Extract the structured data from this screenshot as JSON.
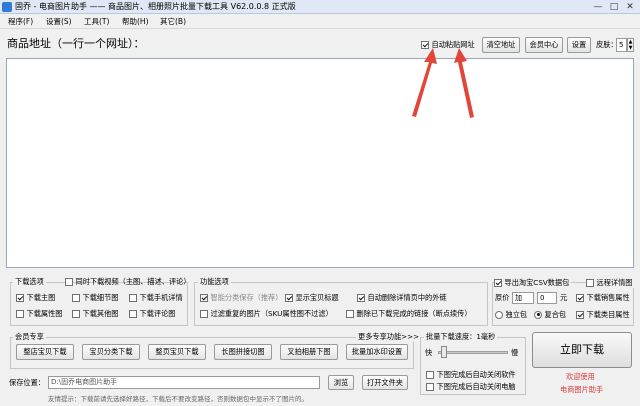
{
  "window": {
    "title": "固乔 - 电商图片助手 —— 商品图片、相册照片批量下载工具 V62.0.0.8 正式版",
    "minimize": "—",
    "maximize": "□",
    "close": "✕"
  },
  "menu": [
    "程序(F)",
    "设置(S)",
    "工具(T)",
    "帮助(H)",
    "其它(B)"
  ],
  "top": {
    "heading": "商品地址（一行一个网址）：",
    "auto_paste_label": "自动粘贴网址",
    "clear_button": "清空地址",
    "member_button": "会员中心",
    "settings_button": "设置",
    "skin_label": "皮肤：",
    "skin_value": "5"
  },
  "download_options": {
    "title": "下载选项",
    "video_label": "同时下载视频（主图、描述、评论）",
    "items": [
      {
        "label": "下载主图",
        "checked": true
      },
      {
        "label": "下载细节图",
        "checked": false
      },
      {
        "label": "下载手机详情",
        "checked": false
      },
      {
        "label": "下载属性图",
        "checked": false
      },
      {
        "label": "下载其他图",
        "checked": false
      },
      {
        "label": "下载评论图",
        "checked": false
      }
    ]
  },
  "function_options": {
    "title": "功能选项",
    "items": [
      {
        "label": "智能分类保存（推荐）",
        "checked": true,
        "disabled": true
      },
      {
        "label": "显示宝贝标题",
        "checked": true
      },
      {
        "label": "自动删除详情页中的外链",
        "checked": true
      },
      {
        "label": "过滤重复的图片（SKU属性图不过滤）",
        "checked": false
      },
      {
        "label": "删除已下载完成的链接（断点续传）",
        "checked": false
      }
    ]
  },
  "export": {
    "csv_label": "导出淘宝CSV数据包",
    "remote_label": "远程详情图",
    "price_label": "原价",
    "price_op": "加",
    "price_value": "0",
    "price_unit": "元",
    "sales_label": "下载销售属性",
    "single_label": "独立包",
    "combined_label": "复合包",
    "category_label": "下载类目属性"
  },
  "vip": {
    "title": "会员专享",
    "more_label": "更多专享功能>>>",
    "buttons": [
      "整店宝贝下载",
      "宝贝分类下载",
      "整页宝贝下载",
      "长图拼接切图",
      "叉拍相册下图",
      "批量加水印设置"
    ]
  },
  "speed": {
    "title": "批量下载速度：1毫秒",
    "fast": "快",
    "slow": "慢",
    "level": 0.05
  },
  "after_download": [
    "下图完成后自动关闭软件",
    "下图完成后自动关闭电脑"
  ],
  "start_button": "立即下载",
  "welcome": [
    "欢迎使用",
    "电商图片助手"
  ],
  "save": {
    "label": "保存位置：",
    "path": "D:\\固乔电商图片助手",
    "browse_button": "浏览",
    "open_button": "打开文件夹"
  },
  "tip": "友情提示：下载前请先选择好路径，下载后不要改变路径，否则数据包中显示不了图片的。",
  "colors": {
    "accent_red": "#e2463b",
    "welcome_red": "#d9383a"
  }
}
